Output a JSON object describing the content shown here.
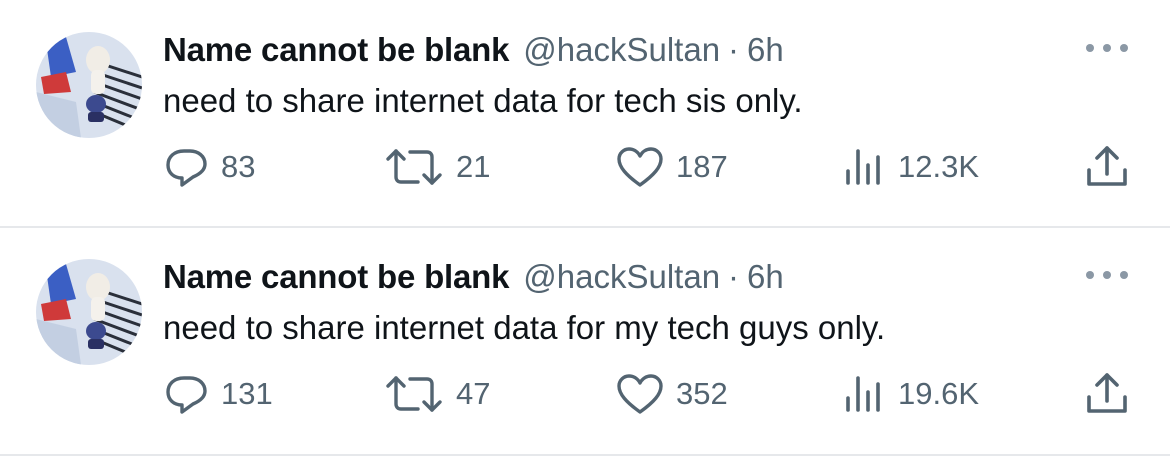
{
  "tweets": [
    {
      "author_name": "Name cannot be blank",
      "handle": "@hackSultan",
      "separator": "·",
      "time": "6h",
      "text": "need to share internet data for tech sis only.",
      "replies": "83",
      "retweets": "21",
      "likes": "187",
      "views": "12.3K"
    },
    {
      "author_name": "Name cannot be blank",
      "handle": "@hackSultan",
      "separator": "·",
      "time": "6h",
      "text": "need to share internet data for my tech guys only.",
      "replies": "131",
      "retweets": "47",
      "likes": "352",
      "views": "19.6K"
    }
  ],
  "icons": {
    "reply": "reply-icon",
    "retweet": "retweet-icon",
    "like": "heart-icon",
    "views": "views-icon",
    "share": "share-icon",
    "more": "more-icon"
  },
  "colors": {
    "text_primary": "#0f1419",
    "text_secondary": "#536471",
    "divider": "#e6e8eb"
  }
}
